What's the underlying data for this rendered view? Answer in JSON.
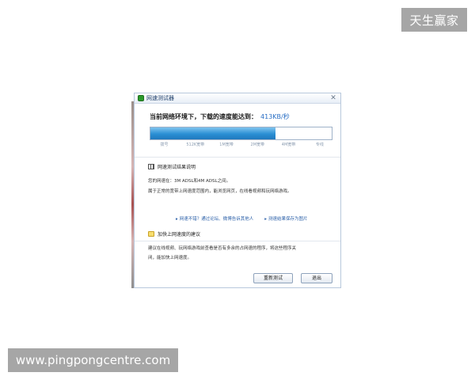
{
  "watermarks": {
    "top_right": "天生赢家",
    "bottom_left": "www.pingpongcentre.com"
  },
  "dialog": {
    "title": "网速测试器",
    "close_glyph": "✕",
    "headline": "当前网络环境下，下载的速度能达到：",
    "speed_value": "413KB/秒",
    "progress_fraction": 0.69,
    "scale_labels": [
      "拨号",
      "512K宽带",
      "1M宽带",
      "2M宽带",
      "4M宽带",
      "专线"
    ],
    "result_section_title": "网速测试结果说明",
    "result_line1": "您的网速在：3M ADSL和4M ADSL之间。",
    "result_line2": "属于正常的宽带上网速度范围内，能浏览网页，在线看视频和玩网络游戏。",
    "link_feedback": "网速不错？通过论坛、微博告诉其他人",
    "link_save": "测速结果保存为图片",
    "tips_section_title": "加快上网速度的建议",
    "tips_line1": "建议在线视频、玩网络游戏前查看是否有多余的占网速的程序，将这些程序关",
    "tips_line2": "闭，能加快上网速度。",
    "retest_button": "重新测试",
    "exit_button": "退出",
    "colors": {
      "progress_fill": "#2a8fd4",
      "link": "#2a5fa8",
      "speed": "#2a6fc4"
    }
  }
}
